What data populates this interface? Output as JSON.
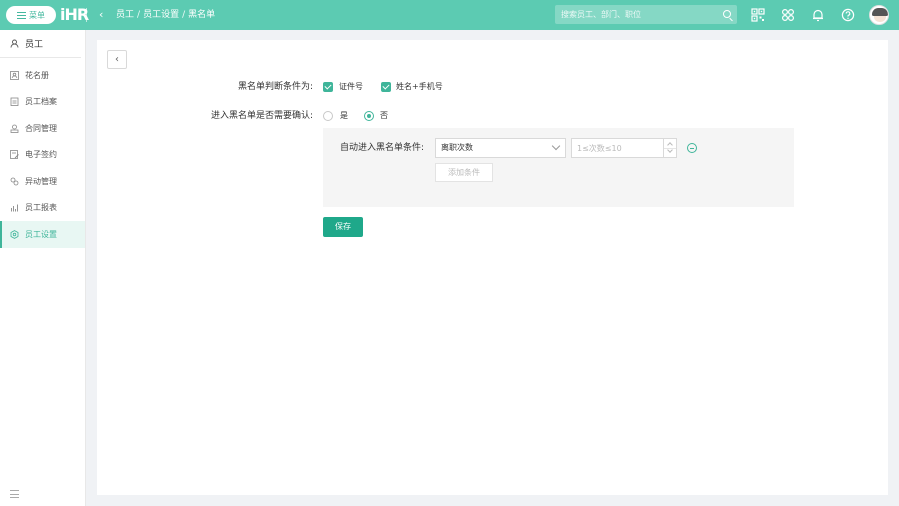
{
  "topbar": {
    "menu_label": "菜单",
    "logo_text": "iHR",
    "breadcrumb": [
      "员工",
      "员工设置",
      "黑名单"
    ],
    "breadcrumb_sep": "/",
    "search_placeholder": "搜索员工、部门、职位",
    "icons": [
      "qrcode-icon",
      "apps-icon",
      "bell-icon",
      "help-icon"
    ]
  },
  "sidebar": {
    "header": "员工",
    "items": [
      {
        "label": "花名册",
        "icon": "roster-icon",
        "active": false
      },
      {
        "label": "员工档案",
        "icon": "archive-icon",
        "active": false
      },
      {
        "label": "合同管理",
        "icon": "contract-icon",
        "active": false
      },
      {
        "label": "电子签约",
        "icon": "esign-icon",
        "active": false
      },
      {
        "label": "异动管理",
        "icon": "transfer-icon",
        "active": false
      },
      {
        "label": "员工报表",
        "icon": "report-icon",
        "active": false
      },
      {
        "label": "员工设置",
        "icon": "settings-icon",
        "active": true
      }
    ]
  },
  "form": {
    "criteria_label": "黑名单判断条件为:",
    "criteria_options": [
      {
        "label": "证件号",
        "checked": true
      },
      {
        "label": "姓名+手机号",
        "checked": true
      }
    ],
    "confirm_label": "进入黑名单是否需要确认:",
    "confirm_options": [
      {
        "label": "是",
        "selected": false
      },
      {
        "label": "否",
        "selected": true
      }
    ],
    "auto_label": "自动进入黑名单条件:",
    "auto_condition": {
      "type_value": "离职次数",
      "count_placeholder": "1≤次数≤10"
    },
    "add_condition_label": "添加条件",
    "save_label": "保存"
  },
  "colors": {
    "topbar": "#5ccbb2",
    "accent": "#3fb59a",
    "save_button": "#1fa88a"
  }
}
